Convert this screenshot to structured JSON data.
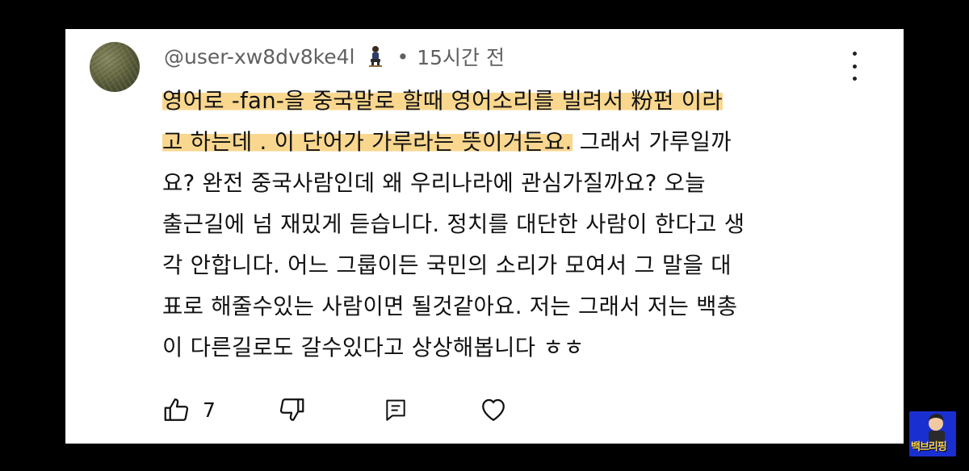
{
  "comment": {
    "username": "@user-xw8dv8ke4l",
    "badge_icon": "person-sitting-icon",
    "separator": "•",
    "time": "15시간 전",
    "lines": [
      {
        "highlight": "영어로 -fan-을  중국말로 할때 영어소리를 빌려서 粉펀  이라",
        "rest": ""
      },
      {
        "highlight": "고 하는데  . 이 단어가 가루라는 뜻이거든요.",
        "rest": " 그래서 가루일까"
      },
      {
        "highlight": "",
        "rest": "요? 완전 중국사람인데 왜 우리나라에 관심가질까요?   오늘"
      },
      {
        "highlight": "",
        "rest": "출근길에 넘 재밌게 듣습니다. 정치를 대단한 사람이 한다고 생"
      },
      {
        "highlight": "",
        "rest": "각 안합니다. 어느 그룹이든 국민의 소리가 모여서 그 말을 대"
      },
      {
        "highlight": "",
        "rest": "표로 해줄수있는 사람이면 될것같아요.  저는 그래서 저는 백총"
      },
      {
        "highlight": "",
        "rest": "이 다른길로도 갈수있다고 상상해봅니다 ㅎㅎ"
      }
    ],
    "highlight_color": "#f7cc6e",
    "like_count": "7"
  },
  "icons": {
    "menu": "more-vert-icon",
    "like": "thumbs-up-icon",
    "dislike": "thumbs-down-icon",
    "reply": "reply-icon",
    "heart": "heart-icon"
  },
  "logo": {
    "text": "백브리핑",
    "bg_color": "#1a2fd0",
    "text_color": "#ffd84a"
  }
}
